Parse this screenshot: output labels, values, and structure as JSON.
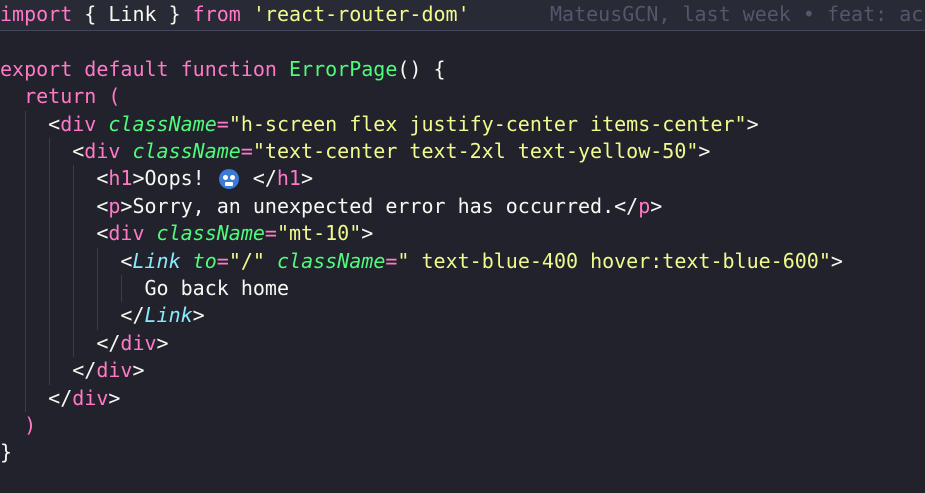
{
  "colors": {
    "background": "#21222c",
    "current_line": "#282a36",
    "keyword": "#ff79c6",
    "function": "#50fa7b",
    "string": "#f1fa8c",
    "text": "#f8f8f2",
    "component": "#8be9fd",
    "blame": "#52576b",
    "paren": "#ff79c6"
  },
  "git_blame": "MateusGCN, last week • feat: ac",
  "lines": [
    {
      "tokens": [
        {
          "t": "import",
          "c": "#ff79c6"
        },
        {
          "t": " { ",
          "c": "#f8f8f2"
        },
        {
          "t": "Link",
          "c": "#f8f8f2"
        },
        {
          "t": " } ",
          "c": "#f8f8f2"
        },
        {
          "t": "from",
          "c": "#ff79c6"
        },
        {
          "t": " ",
          "c": "#f8f8f2"
        },
        {
          "t": "'react-router-dom'",
          "c": "#f1fa8c"
        }
      ]
    },
    {
      "tokens": []
    },
    {
      "tokens": [
        {
          "t": "export",
          "c": "#ff79c6"
        },
        {
          "t": " ",
          "c": "#f8f8f2"
        },
        {
          "t": "default",
          "c": "#ff79c6"
        },
        {
          "t": " ",
          "c": "#f8f8f2"
        },
        {
          "t": "function",
          "c": "#ff79c6"
        },
        {
          "t": " ",
          "c": "#f8f8f2"
        },
        {
          "t": "ErrorPage",
          "c": "#50fa7b"
        },
        {
          "t": "() {",
          "c": "#f8f8f2"
        }
      ]
    },
    {
      "tokens": [
        {
          "t": "  return",
          "c": "#ff79c6"
        },
        {
          "t": " (",
          "c": "#ff79c6"
        }
      ]
    },
    {
      "tokens": [
        {
          "t": "    <",
          "c": "#f8f8f2"
        },
        {
          "t": "div",
          "c": "#ff79c6"
        },
        {
          "t": " ",
          "c": "#f8f8f2"
        },
        {
          "t": "className",
          "c": "#50fa7b",
          "i": true
        },
        {
          "t": "=",
          "c": "#ff79c6"
        },
        {
          "t": "\"h-screen flex justify-center items-center\"",
          "c": "#f1fa8c"
        },
        {
          "t": ">",
          "c": "#f8f8f2"
        }
      ]
    },
    {
      "tokens": [
        {
          "t": "      <",
          "c": "#f8f8f2"
        },
        {
          "t": "div",
          "c": "#ff79c6"
        },
        {
          "t": " ",
          "c": "#f8f8f2"
        },
        {
          "t": "className",
          "c": "#50fa7b",
          "i": true
        },
        {
          "t": "=",
          "c": "#ff79c6"
        },
        {
          "t": "\"text-center text-2xl text-yellow-50\"",
          "c": "#f1fa8c"
        },
        {
          "t": ">",
          "c": "#f8f8f2"
        }
      ]
    },
    {
      "tokens": [
        {
          "t": "        <",
          "c": "#f8f8f2"
        },
        {
          "t": "h1",
          "c": "#ff79c6"
        },
        {
          "t": ">Oops! ",
          "c": "#f8f8f2"
        },
        {
          "emoji": true
        },
        {
          "t": " </",
          "c": "#f8f8f2"
        },
        {
          "t": "h1",
          "c": "#ff79c6"
        },
        {
          "t": ">",
          "c": "#f8f8f2"
        }
      ]
    },
    {
      "tokens": [
        {
          "t": "        <",
          "c": "#f8f8f2"
        },
        {
          "t": "p",
          "c": "#ff79c6"
        },
        {
          "t": ">Sorry, an unexpected error has occurred.</",
          "c": "#f8f8f2"
        },
        {
          "t": "p",
          "c": "#ff79c6"
        },
        {
          "t": ">",
          "c": "#f8f8f2"
        }
      ]
    },
    {
      "tokens": [
        {
          "t": "        <",
          "c": "#f8f8f2"
        },
        {
          "t": "div",
          "c": "#ff79c6"
        },
        {
          "t": " ",
          "c": "#f8f8f2"
        },
        {
          "t": "className",
          "c": "#50fa7b",
          "i": true
        },
        {
          "t": "=",
          "c": "#ff79c6"
        },
        {
          "t": "\"mt-10\"",
          "c": "#f1fa8c"
        },
        {
          "t": ">",
          "c": "#f8f8f2"
        }
      ]
    },
    {
      "tokens": [
        {
          "t": "          <",
          "c": "#f8f8f2"
        },
        {
          "t": "Link",
          "c": "#8be9fd",
          "i": true
        },
        {
          "t": " ",
          "c": "#f8f8f2"
        },
        {
          "t": "to",
          "c": "#50fa7b",
          "i": true
        },
        {
          "t": "=",
          "c": "#ff79c6"
        },
        {
          "t": "\"/\"",
          "c": "#f1fa8c"
        },
        {
          "t": " ",
          "c": "#f8f8f2"
        },
        {
          "t": "className",
          "c": "#50fa7b",
          "i": true
        },
        {
          "t": "=",
          "c": "#ff79c6"
        },
        {
          "t": "\" text-blue-400 hover:text-blue-600\"",
          "c": "#f1fa8c"
        },
        {
          "t": ">",
          "c": "#f8f8f2"
        }
      ]
    },
    {
      "tokens": [
        {
          "t": "            Go back home",
          "c": "#f8f8f2"
        }
      ]
    },
    {
      "tokens": [
        {
          "t": "          </",
          "c": "#f8f8f2"
        },
        {
          "t": "Link",
          "c": "#8be9fd",
          "i": true
        },
        {
          "t": ">",
          "c": "#f8f8f2"
        }
      ]
    },
    {
      "tokens": [
        {
          "t": "        </",
          "c": "#f8f8f2"
        },
        {
          "t": "div",
          "c": "#ff79c6"
        },
        {
          "t": ">",
          "c": "#f8f8f2"
        }
      ]
    },
    {
      "tokens": [
        {
          "t": "      </",
          "c": "#f8f8f2"
        },
        {
          "t": "div",
          "c": "#ff79c6"
        },
        {
          "t": ">",
          "c": "#f8f8f2"
        }
      ]
    },
    {
      "tokens": [
        {
          "t": "    </",
          "c": "#f8f8f2"
        },
        {
          "t": "div",
          "c": "#ff79c6"
        },
        {
          "t": ">",
          "c": "#f8f8f2"
        }
      ]
    },
    {
      "tokens": [
        {
          "t": "  )",
          "c": "#ff79c6"
        }
      ]
    },
    {
      "tokens": [
        {
          "t": "}",
          "c": "#f8f8f2"
        }
      ]
    }
  ]
}
